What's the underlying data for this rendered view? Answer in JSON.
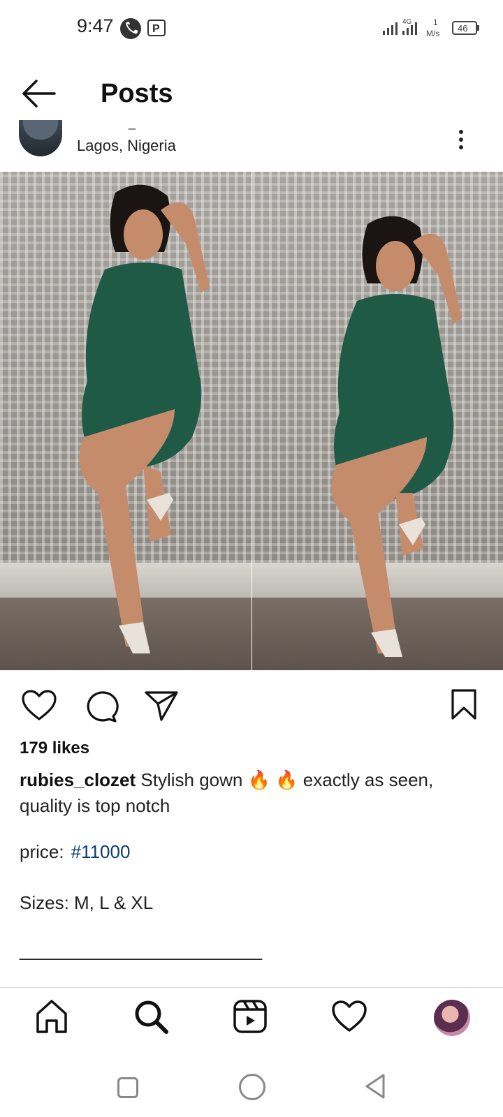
{
  "status_bar": {
    "time": "9:47",
    "network": "4G",
    "speed_value": "1",
    "speed_unit": "M/s",
    "battery": "46"
  },
  "header": {
    "title": "Posts"
  },
  "post": {
    "username_stub": "_",
    "location": "Lagos, Nigeria",
    "photo_alts": [
      "woman in green bodycon dress",
      "woman in green bodycon dress"
    ],
    "likes": "179 likes",
    "caption_user": "rubies_clozet",
    "caption_text_1": " Stylish  gown ",
    "caption_emoji": "🔥 🔥",
    "caption_text_2": " exactly as seen, quality is top notch",
    "price_label": "price:",
    "price_tag": "#11000",
    "sizes": "Sizes:  M, L & XL",
    "separator": "________________________"
  },
  "icons": {
    "like": "heart-icon",
    "comment": "comment-icon",
    "share": "share-icon",
    "save": "bookmark-icon"
  },
  "colors": {
    "hashtag": "#0b3a78",
    "dress": "#1f5a46"
  }
}
